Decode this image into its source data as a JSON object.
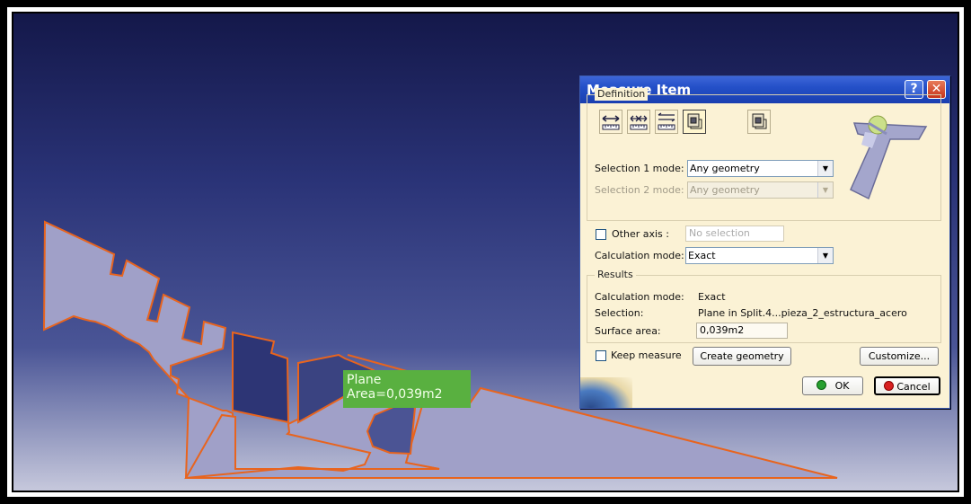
{
  "viewport": {
    "measure_label": {
      "line1": "Plane",
      "line2": "Area=0,039m2"
    }
  },
  "dialog": {
    "title": "Measure Item",
    "help_glyph": "?",
    "close_glyph": "✕",
    "definition": {
      "title": "Definition",
      "tools": [
        "measure-between-icon",
        "measure-between-chain-icon",
        "measure-between-fan-icon",
        "measure-item-icon",
        "measure-thickness-icon"
      ],
      "selection1_label": "Selection 1 mode:",
      "selection1_value": "Any geometry",
      "selection2_label": "Selection 2 mode:",
      "selection2_value": "Any geometry"
    },
    "other_axis": {
      "label": "Other axis :",
      "placeholder": "No selection"
    },
    "calculation": {
      "label": "Calculation mode:",
      "value": "Exact"
    },
    "results": {
      "title": "Results",
      "calc_label": "Calculation mode:",
      "calc_value": "Exact",
      "selection_label": "Selection:",
      "selection_value": "Plane in Split.4...pieza_2_estructura_acero",
      "area_label": "Surface area:",
      "area_value": "0,039m2"
    },
    "keep_measure_label": "Keep measure",
    "create_geometry_label": "Create geometry",
    "customize_label": "Customize...",
    "ok_label": "OK",
    "cancel_label": "Cancel",
    "colors": {
      "titlebar": "#2450c8",
      "body": "#fbf2d5",
      "part_fill": "#a0a0c8",
      "part_edge": "#e8641e",
      "label_bg": "#59b040"
    }
  }
}
